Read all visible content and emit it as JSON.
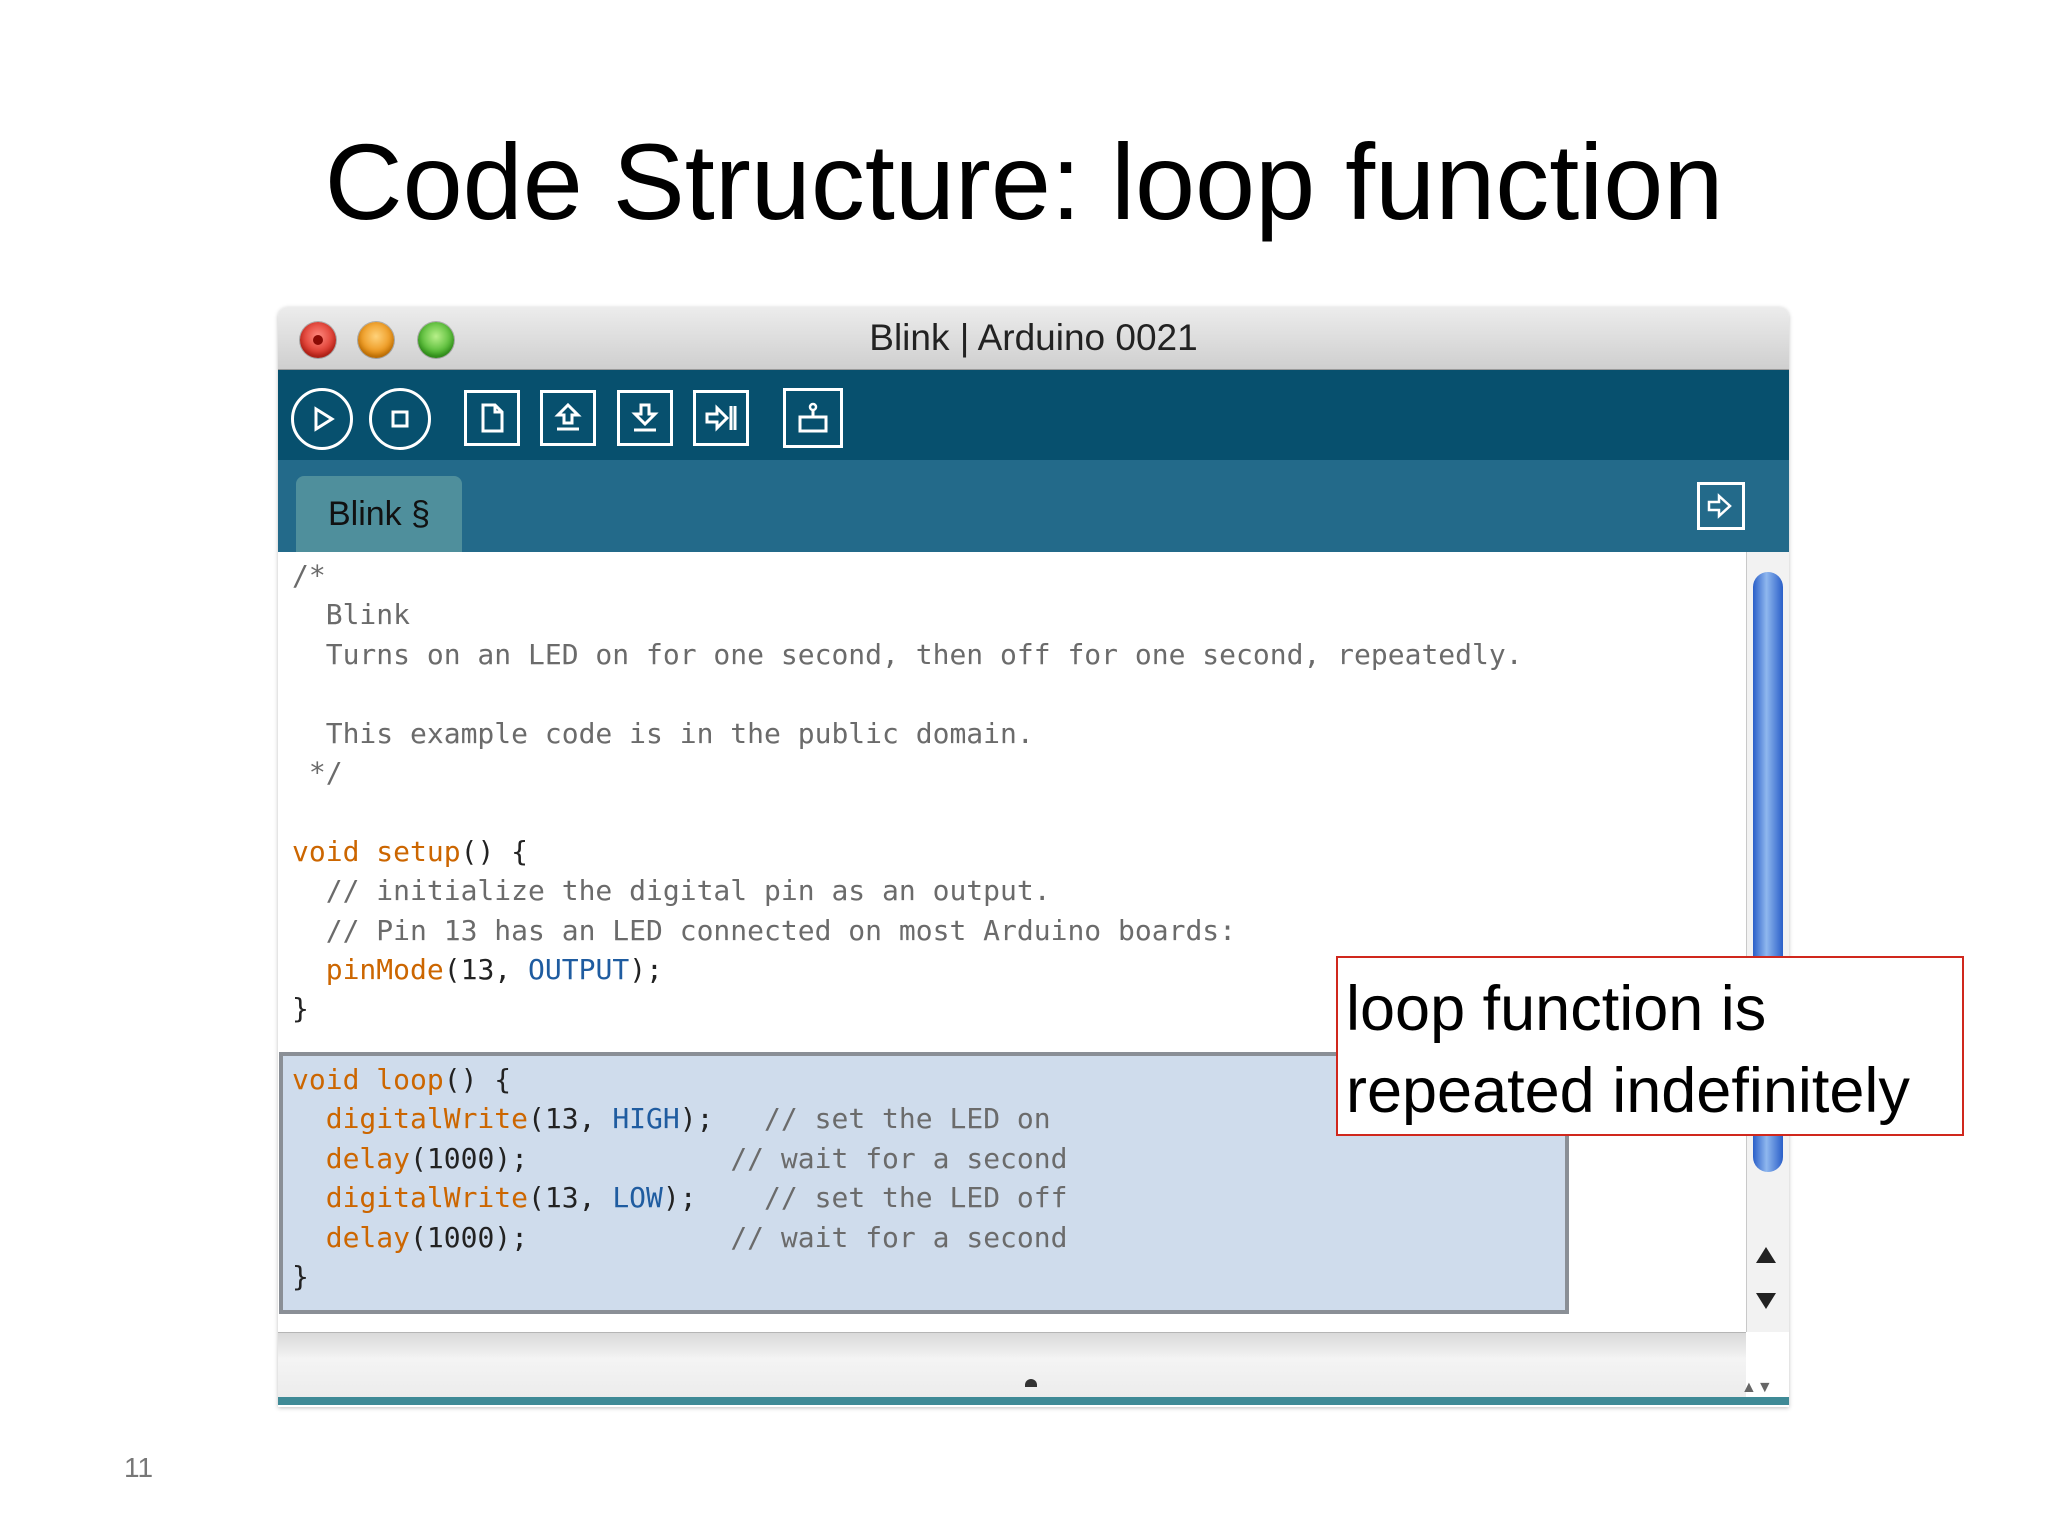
{
  "slide": {
    "title": "Code Structure: loop function",
    "page_number": "11",
    "callout_line1": "loop function is",
    "callout_line2": "repeated indefinitely"
  },
  "window": {
    "title": "Blink | Arduino 0021"
  },
  "toolbar": {
    "buttons": [
      "verify-icon",
      "stop-icon",
      "new-icon",
      "open-icon",
      "save-icon",
      "upload-icon",
      "serial-monitor-icon"
    ]
  },
  "tabs": [
    {
      "label": "Blink §"
    }
  ],
  "code": {
    "comment_open": "/*",
    "comment_title": "  Blink",
    "comment_desc": "  Turns on an LED on for one second, then off for one second, repeatedly.",
    "comment_license": "  This example code is in the public domain.",
    "comment_close": " */",
    "setup_void": "void",
    "setup_name": "setup",
    "setup_rest": "() {",
    "setup_c1": "  // initialize the digital pin as an output.",
    "setup_c2": "  // Pin 13 has an LED connected on most Arduino boards:",
    "pinmode_fn": "pinMode",
    "pinmode_args_a": "(13, ",
    "pinmode_const": "OUTPUT",
    "pinmode_args_b": ");",
    "close_brace": "}",
    "loop_void": "void",
    "loop_name": "loop",
    "loop_rest": "() {",
    "dw_fn": "digitalWrite",
    "dw1_args_a": "(13, ",
    "dw1_const": "HIGH",
    "dw1_args_b": ");",
    "dw1_comment": "// set the LED on",
    "delay_fn": "delay",
    "delay_args": "(1000);",
    "delay1_comment": "// wait for a second",
    "dw2_args_a": "(13, ",
    "dw2_const": "LOW",
    "dw2_args_b": ");",
    "dw2_comment": "// set the LED off",
    "delay2_comment": "// wait for a second",
    "loop_close": "}"
  },
  "colors": {
    "toolbar": "#07506e",
    "tabbar": "#236a8a",
    "keyword": "#cc6600",
    "constant": "#1f5ca0",
    "loop_highlight": "#cfdcec",
    "callout_border": "#d0281d"
  }
}
